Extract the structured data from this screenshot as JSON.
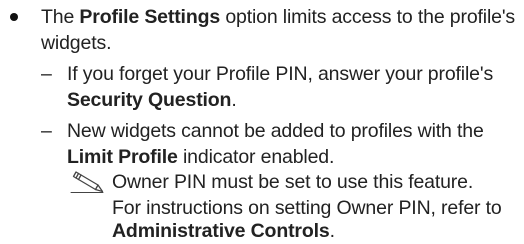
{
  "bullet": {
    "line1": {
      "pre": "The ",
      "bold": "Profile Settings",
      "post": " option limits access to the profile's"
    },
    "line2": "widgets."
  },
  "sub_items": [
    {
      "dash": "–",
      "line1": "If you forget your Profile PIN, answer your profile's",
      "line2_bold": "Security Question",
      "line2_post": "."
    },
    {
      "dash": "–",
      "line1": "New widgets cannot be added to profiles with the",
      "line2_bold": "Limit Profile",
      "line2_post": " indicator enabled."
    }
  ],
  "note": {
    "icon": "pencil-note-icon",
    "line1": "Owner PIN must be set to use this feature.",
    "line2": "For instructions on setting Owner PIN, refer to",
    "line3_bold": "Administrative Controls",
    "line3_post": "."
  }
}
